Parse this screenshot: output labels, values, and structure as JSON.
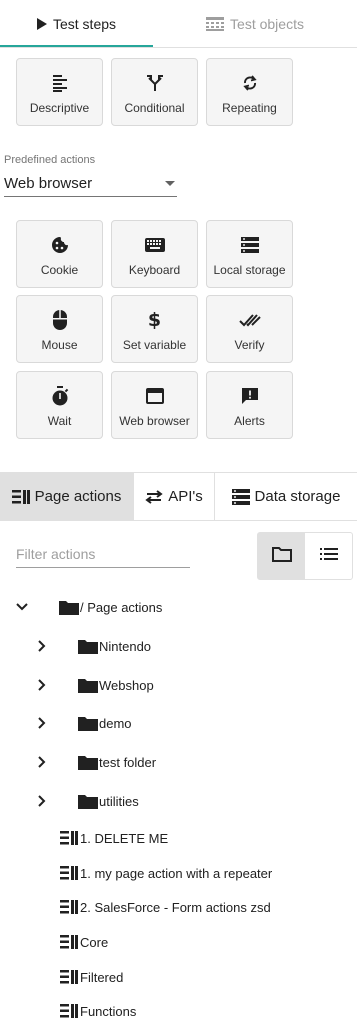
{
  "tabs": {
    "test_steps": "Test steps",
    "test_objects": "Test objects"
  },
  "step_types": [
    {
      "label": "Descriptive",
      "icon": "descriptive-icon"
    },
    {
      "label": "Conditional",
      "icon": "conditional-icon"
    },
    {
      "label": "Repeating",
      "icon": "repeating-icon"
    }
  ],
  "predefined": {
    "label": "Predefined actions",
    "selected": "Web browser"
  },
  "actions": [
    {
      "label": "Cookie",
      "icon": "cookie-icon"
    },
    {
      "label": "Keyboard",
      "icon": "keyboard-icon"
    },
    {
      "label": "Local storage",
      "icon": "storage-icon"
    },
    {
      "label": "Mouse",
      "icon": "mouse-icon"
    },
    {
      "label": "Set variable",
      "icon": "dollar-icon"
    },
    {
      "label": "Verify",
      "icon": "double-check-icon"
    },
    {
      "label": "Wait",
      "icon": "stopwatch-icon"
    },
    {
      "label": "Web browser",
      "icon": "browser-window-icon"
    },
    {
      "label": "Alerts",
      "icon": "alert-message-icon"
    }
  ],
  "library_tabs": {
    "page_actions": "Page actions",
    "apis": "API's",
    "data_storage": "Data storage"
  },
  "filter": {
    "placeholder": "Filter actions",
    "value": ""
  },
  "tree": {
    "root": "/ Page actions",
    "folders": [
      "Nintendo",
      "Webshop",
      "demo",
      "test folder",
      "utilities"
    ],
    "items": [
      "1. DELETE ME",
      "1. my page action with a repeater",
      "2. SalesForce - Form actions zsd",
      "Core",
      "Filtered",
      "Functions"
    ]
  },
  "colors": {
    "accent": "#26a69a",
    "tile_bg": "#f5f5f5",
    "active_tab_bg": "#e0e0e0"
  }
}
